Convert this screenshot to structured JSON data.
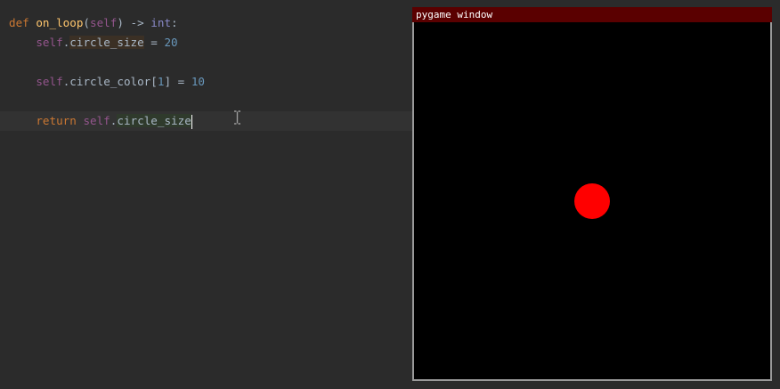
{
  "editor": {
    "line1": {
      "kw_def": "def",
      "func_name": "on_loop",
      "paren_open": "(",
      "param_self": "self",
      "paren_close_arrow": ") ->",
      "return_type": "int",
      "colon": ":"
    },
    "line2": {
      "self": "self",
      "dot": ".",
      "attr": "circle_size",
      "op": " = ",
      "value": "20"
    },
    "line3": {
      "self": "self",
      "dot": ".",
      "attr": "circle_color",
      "bracket_open": "[",
      "index": "1",
      "bracket_close": "]",
      "op": " = ",
      "value": "10"
    },
    "line4": {
      "kw_return": "return",
      "self": "self",
      "dot": ".",
      "attr": "circle_size"
    }
  },
  "pygame_window": {
    "title": "pygame window",
    "circle_color": "#ff0000",
    "titlebar_color": "#5a0000"
  }
}
